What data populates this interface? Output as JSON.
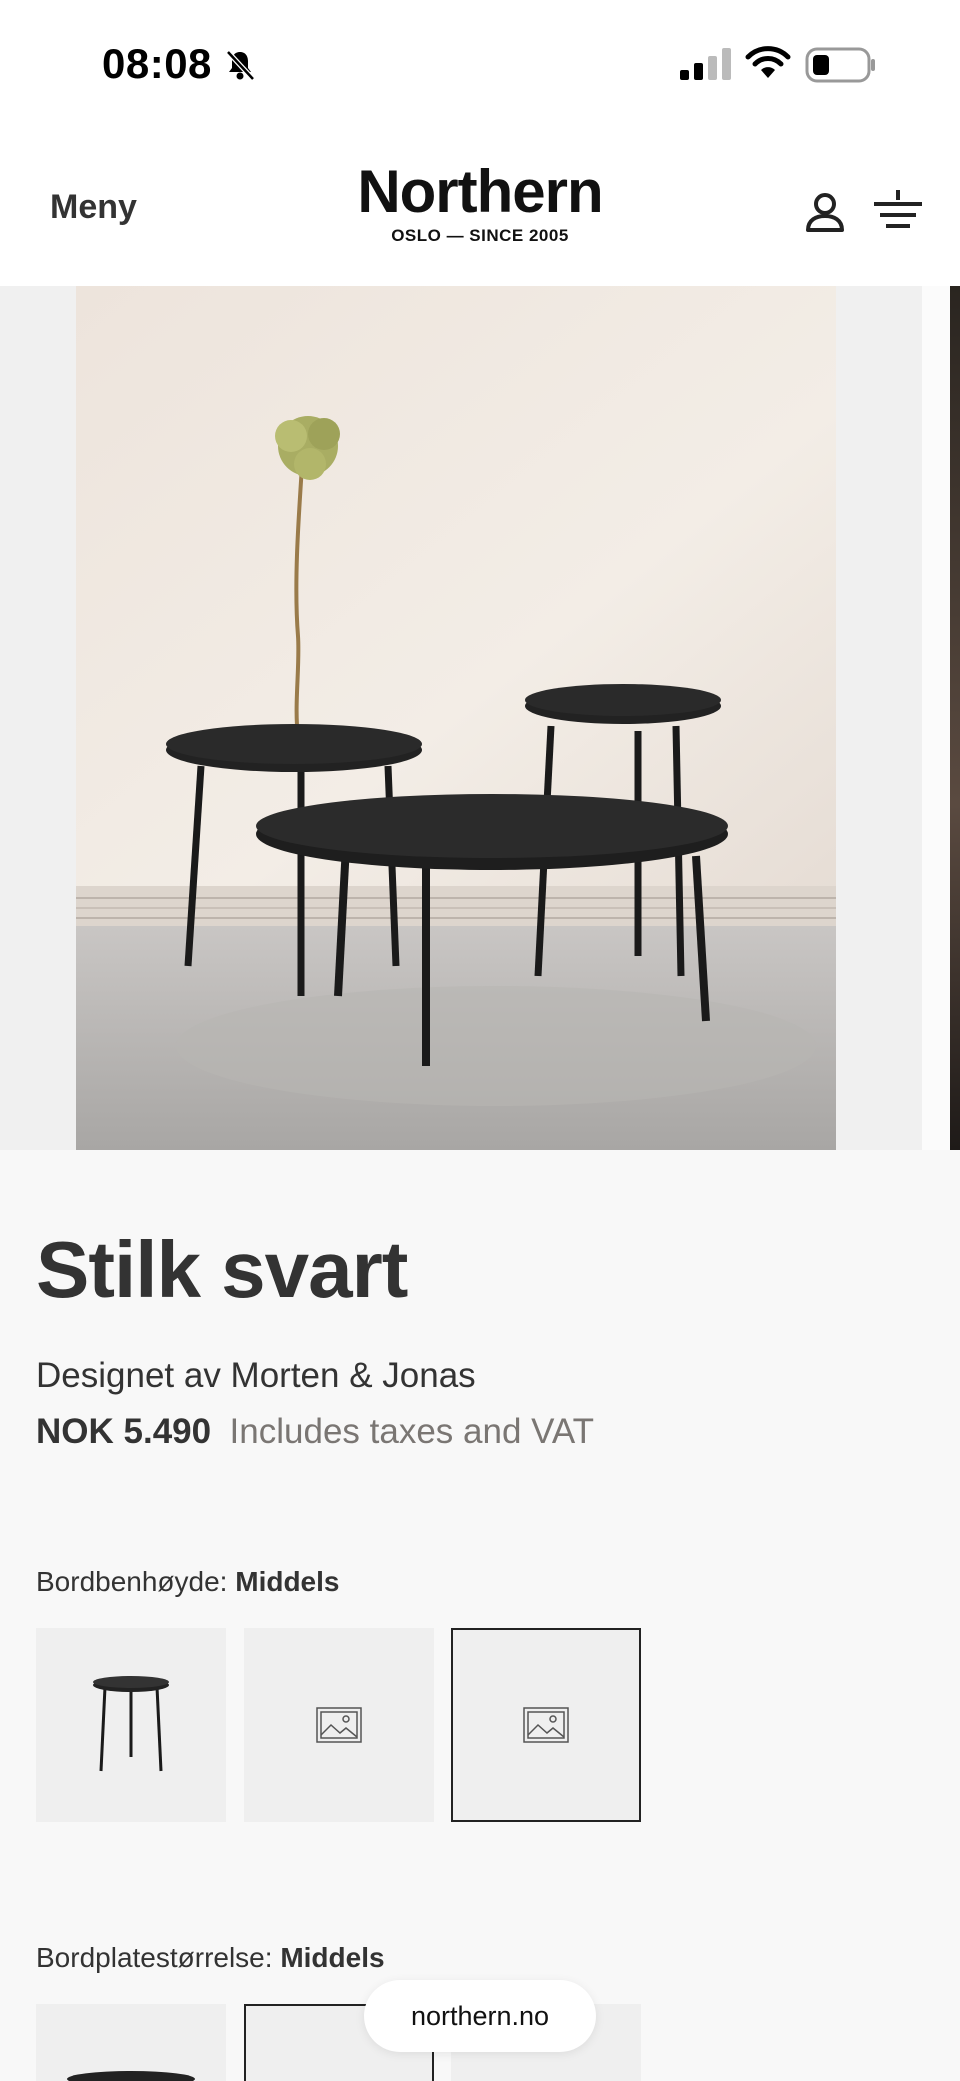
{
  "status_bar": {
    "time": "08:08"
  },
  "header": {
    "menu_label": "Meny",
    "brand_name": "Northern",
    "brand_tagline": "OSLO — SINCE 2005"
  },
  "product": {
    "title": "Stilk svart",
    "designer": "Designet av Morten & Jonas",
    "price": "NOK 5.490",
    "tax_note": "Includes taxes and VAT"
  },
  "options": {
    "leg_height": {
      "label": "Bordbenhøyde:",
      "value": "Middels"
    },
    "top_size": {
      "label": "Bordplatestørrelse:",
      "value": "Middels"
    }
  },
  "browser": {
    "url": "northern.no"
  }
}
